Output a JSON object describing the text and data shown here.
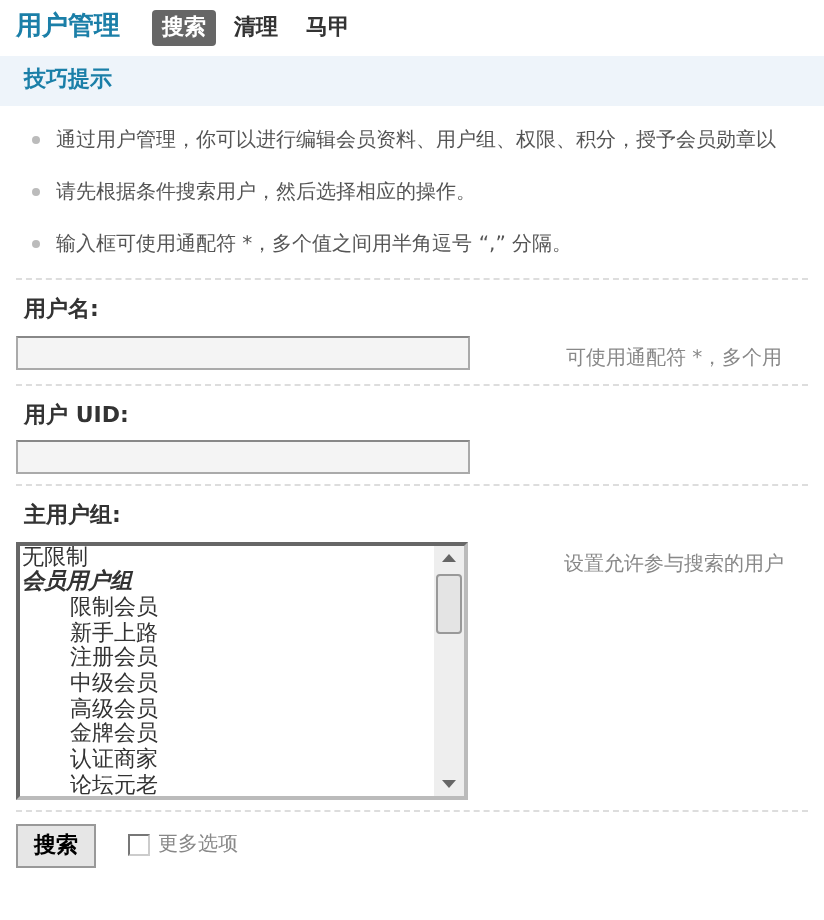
{
  "header": {
    "title": "用户管理",
    "tabs": [
      {
        "label": "搜索",
        "selected": true
      },
      {
        "label": "清理",
        "selected": false
      },
      {
        "label": "马甲",
        "selected": false
      }
    ]
  },
  "tips": {
    "title": "技巧提示",
    "items": [
      "通过用户管理，你可以进行编辑会员资料、用户组、权限、积分，授予会员勋章以",
      "请先根据条件搜索用户，然后选择相应的操作。",
      "输入框可使用通配符 *，多个值之间用半角逗号 “,” 分隔。"
    ]
  },
  "form": {
    "fields": [
      {
        "kind": "text",
        "label": "用户名:",
        "hint": "可使用通配符 *，多个用"
      },
      {
        "kind": "text",
        "label": "用户  UID:"
      },
      {
        "kind": "list",
        "label": "主用户组:",
        "hint": "设置允许参与搜索的用户",
        "options": [
          {
            "label": "无限制",
            "selected": false
          },
          {
            "label": "会员用户组",
            "kind": "group",
            "children": [
              {
                "label": "限制会员",
                "selected": false
              },
              {
                "label": "新手上路",
                "selected": false
              },
              {
                "label": "注册会员",
                "selected": false
              },
              {
                "label": "中级会员",
                "selected": false
              },
              {
                "label": "高级会员",
                "selected": false
              },
              {
                "label": "金牌会员",
                "selected": false
              },
              {
                "label": "认证商家",
                "selected": false
              },
              {
                "label": "论坛元老",
                "selected": false
              }
            ]
          }
        ]
      }
    ],
    "submit": "搜索",
    "more_options": {
      "label": "更多选项",
      "checked": false
    }
  }
}
